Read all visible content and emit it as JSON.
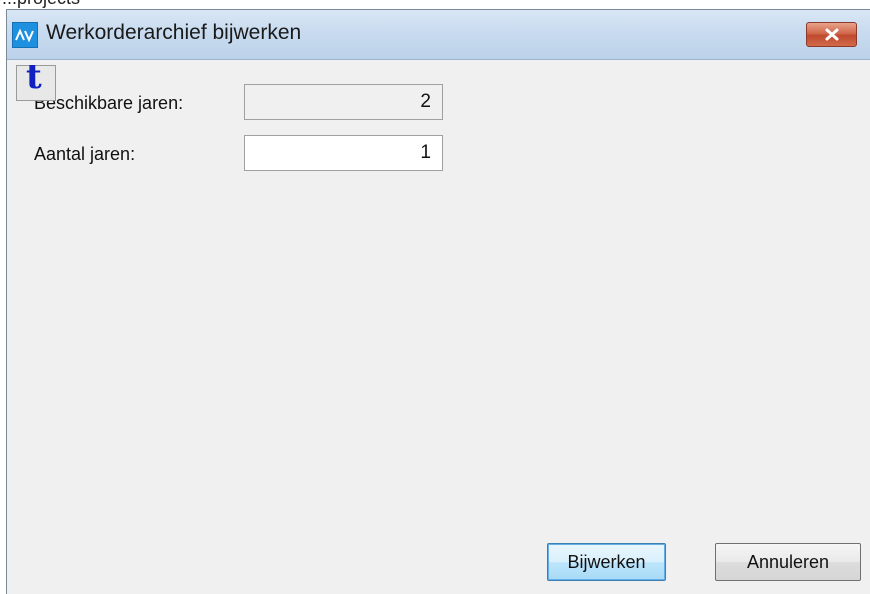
{
  "background_fragment": {
    "text": "...projects"
  },
  "window": {
    "title": "Werkorderarchief bijwerken",
    "app_icon": "av-logo-icon",
    "close_icon": "close-icon"
  },
  "help_button": {
    "glyph": "t",
    "icon": "help-icon"
  },
  "form": {
    "available_years_label": "Beschikbare jaren:",
    "available_years_value": "2",
    "num_years_label": "Aantal jaren:",
    "num_years_value": "1"
  },
  "buttons": {
    "update_label": "Bijwerken",
    "cancel_label": "Annuleren"
  },
  "colors": {
    "titlebar": "#c8dbef",
    "close_button": "#c14a2f",
    "app_icon": "#1e90e0",
    "help_glyph": "#1020c0"
  }
}
